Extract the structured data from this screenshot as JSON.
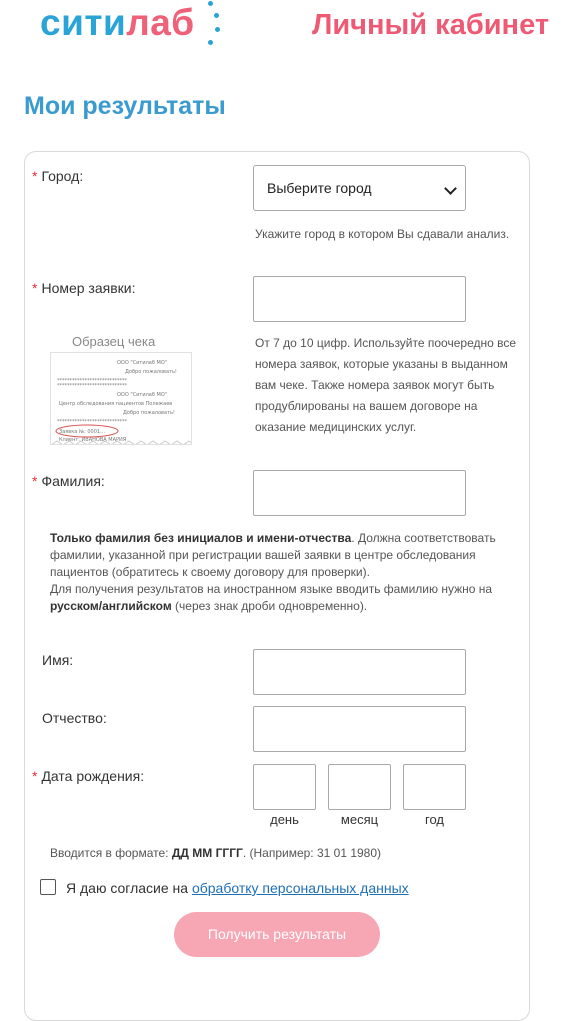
{
  "header": {
    "logo_part1": "сити",
    "logo_part2": "лаб",
    "cabinet_title": "Личный кабинет",
    "accent_blue": "#2aa4d6",
    "accent_pink": "#ee5a74"
  },
  "page_title": "Мои результаты",
  "form": {
    "required_mark": "*",
    "city": {
      "label": "Город:",
      "selected": "Выберите город",
      "hint": "Укажите город в котором Вы сдавали анализ."
    },
    "order": {
      "label": "Номер заявки:",
      "value": "",
      "hint": "От 7 до 10 цифр. Используйте поочередно все номера заявок, которые указаны в выданном вам чеке. Также номера заявок могут быть продублированы на вашем договоре на оказание медицинских услуг."
    },
    "receipt": {
      "caption": "Образец чека",
      "lines": [
        "ООО \"Ситилаб МО\"",
        "Добро пожаловать!",
        "****************************",
        "ООО \"Ситилаб МО\"",
        "Центр обследования пациентов Полежаев",
        "Добро пожаловать!",
        "****************************",
        "Заявка №: 0001…",
        "Клиент: ИВАНОВА МАРИЯ"
      ]
    },
    "surname": {
      "label": "Фамилия:",
      "value": "",
      "note_bold1": "Только фамилия без инициалов и имени-отчества",
      "note_text1": ". Должна соответствовать фамилии, указанной при регистрации вашей заявки в центре обследования пациентов (обратитесь к своему договору для проверки).",
      "note_text2": "Для получения результатов на иностранном языке вводить фамилию нужно на ",
      "note_bold2": "русском/английском",
      "note_text3": " (через знак дроби одновременно)."
    },
    "name": {
      "label": "Имя:",
      "value": ""
    },
    "patronymic": {
      "label": "Отчество:",
      "value": ""
    },
    "birthdate": {
      "label": "Дата рождения:",
      "day_label": "день",
      "month_label": "месяц",
      "year_label": "год",
      "format_text": "Вводится в формате: ",
      "format_bold": "ДД ММ ГГГГ",
      "format_example": ". (Например: 31 01 1980)"
    },
    "consent": {
      "text": "Я даю согласие на ",
      "link": "обработку персональных данных",
      "checked": false
    },
    "submit_label": "Получить результаты"
  }
}
